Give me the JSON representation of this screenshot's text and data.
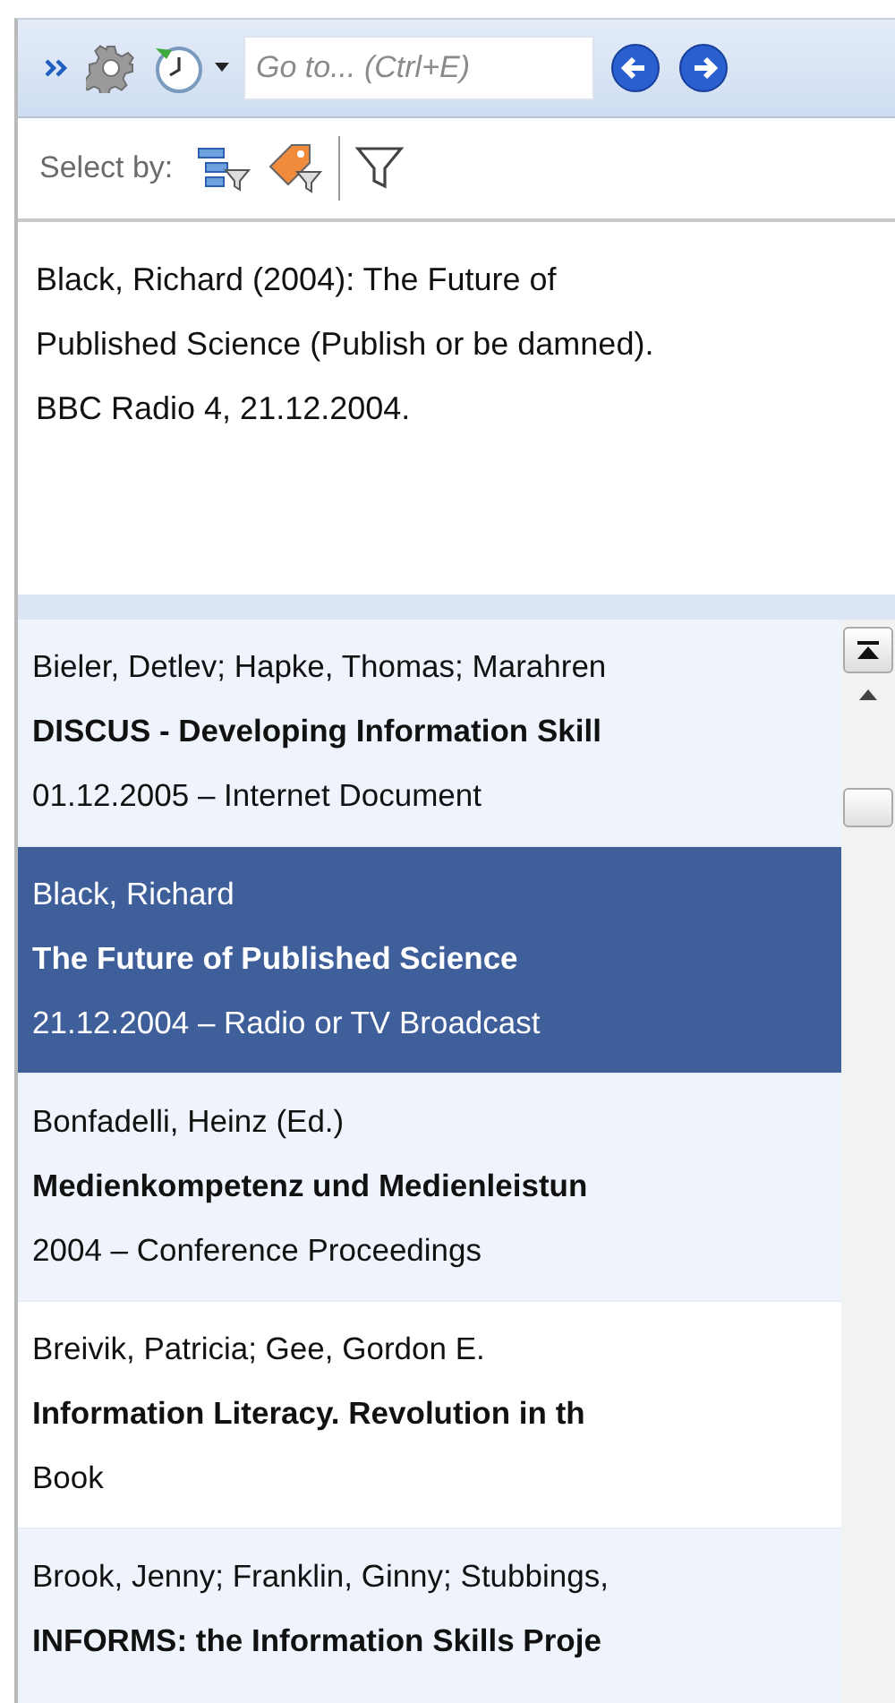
{
  "toolbar": {
    "search": {
      "placeholder": "Go to... (Ctrl+E)"
    }
  },
  "select_bar": {
    "label": "Select by:"
  },
  "preview": {
    "text": "Black, Richard (2004): The Future of Published Science (Publish or be damned). BBC Radio 4, 21.12.2004."
  },
  "references": [
    {
      "authors": "Bieler, Detlev; Hapke, Thomas; Marahren",
      "title": "DISCUS - Developing Information Skill",
      "details": "01.12.2005 – Internet Document",
      "selected": false
    },
    {
      "authors": "Black, Richard",
      "title": "The Future of Published Science",
      "details": "21.12.2004 – Radio or TV Broadcast",
      "selected": true
    },
    {
      "authors": "Bonfadelli, Heinz (Ed.)",
      "title": "Medienkompetenz und Medienleistun",
      "details": "2004 – Conference Proceedings",
      "selected": false
    },
    {
      "authors": "Breivik, Patricia; Gee, Gordon E.",
      "title": "Information Literacy. Revolution in th",
      "details": "Book",
      "selected": false
    },
    {
      "authors": "Brook, Jenny; Franklin, Ginny; Stubbings,",
      "title": "INFORMS: the Information Skills Proje",
      "selected": false
    }
  ]
}
